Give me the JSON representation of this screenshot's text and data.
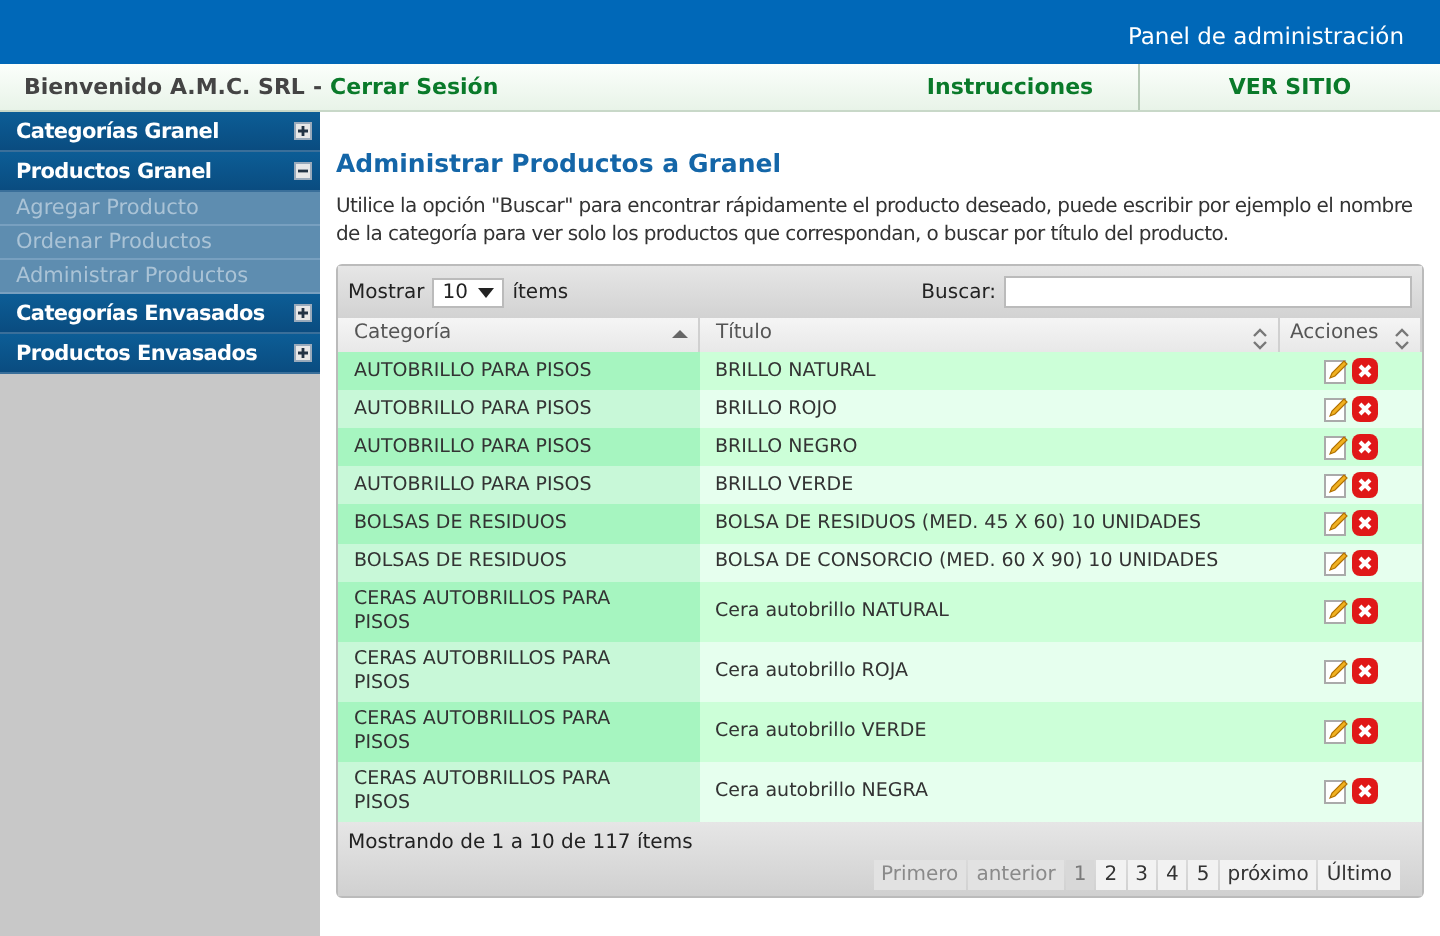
{
  "header": {
    "title": "Panel de administración"
  },
  "topbar": {
    "welcome": "Bienvenido A.M.C. SRL",
    "separator": "-",
    "logout": "Cerrar Sesión",
    "links": [
      "Instrucciones",
      "VER SITIO"
    ]
  },
  "sidebar": {
    "items": [
      {
        "label": "Categorías Granel",
        "expanded": false
      },
      {
        "label": "Productos Granel",
        "expanded": true,
        "children": [
          {
            "label": "Agregar Producto"
          },
          {
            "label": "Ordenar Productos"
          },
          {
            "label": "Administrar Productos"
          }
        ]
      },
      {
        "label": "Categorías Envasados",
        "expanded": false
      },
      {
        "label": "Productos Envasados",
        "expanded": false
      }
    ]
  },
  "main": {
    "heading": "Administrar Productos a Granel",
    "description": "Utilice la opción \"Buscar\" para encontrar rápidamente el producto deseado, puede escribir por ejemplo el nombre de la categoría para ver solo los productos que correspondan, o buscar por título del producto.",
    "length_label_before": "Mostrar",
    "length_value": "10",
    "length_label_after": "ítems",
    "search_label": "Buscar:",
    "table": {
      "columns": [
        {
          "label": "Categoría",
          "sorted": true
        },
        {
          "label": "Título",
          "sorted": false
        },
        {
          "label": "Acciones",
          "sorted": false
        }
      ],
      "rows": [
        {
          "category": "AUTOBRILLO PARA PISOS",
          "title": "BRILLO NATURAL"
        },
        {
          "category": "AUTOBRILLO PARA PISOS",
          "title": "BRILLO ROJO"
        },
        {
          "category": "AUTOBRILLO PARA PISOS",
          "title": "BRILLO NEGRO"
        },
        {
          "category": "AUTOBRILLO PARA PISOS",
          "title": "BRILLO VERDE"
        },
        {
          "category": "BOLSAS DE RESIDUOS",
          "title": "BOLSA DE RESIDUOS (MED. 45 X 60) 10 UNIDADES"
        },
        {
          "category": "BOLSAS DE RESIDUOS",
          "title": "BOLSA DE CONSORCIO (MED. 60 X 90) 10 UNIDADES"
        },
        {
          "category": "CERAS AUTOBRILLOS PARA PISOS",
          "title": "Cera autobrillo NATURAL"
        },
        {
          "category": "CERAS AUTOBRILLOS PARA PISOS",
          "title": "Cera autobrillo ROJA"
        },
        {
          "category": "CERAS AUTOBRILLOS PARA PISOS",
          "title": "Cera autobrillo VERDE"
        },
        {
          "category": "CERAS AUTOBRILLOS PARA PISOS",
          "title": "Cera autobrillo NEGRA"
        }
      ]
    },
    "info": "Mostrando de 1 a 10 de 117 ítems",
    "pagination": [
      {
        "label": "Primero",
        "disabled": true,
        "selected": false
      },
      {
        "label": "anterior",
        "disabled": true,
        "selected": false
      },
      {
        "label": "1",
        "disabled": false,
        "selected": true
      },
      {
        "label": "2",
        "disabled": false,
        "selected": false
      },
      {
        "label": "3",
        "disabled": false,
        "selected": false
      },
      {
        "label": "4",
        "disabled": false,
        "selected": false
      },
      {
        "label": "5",
        "disabled": false,
        "selected": false
      },
      {
        "label": "próximo",
        "disabled": false,
        "selected": false
      },
      {
        "label": "Último",
        "disabled": false,
        "selected": false
      }
    ]
  }
}
